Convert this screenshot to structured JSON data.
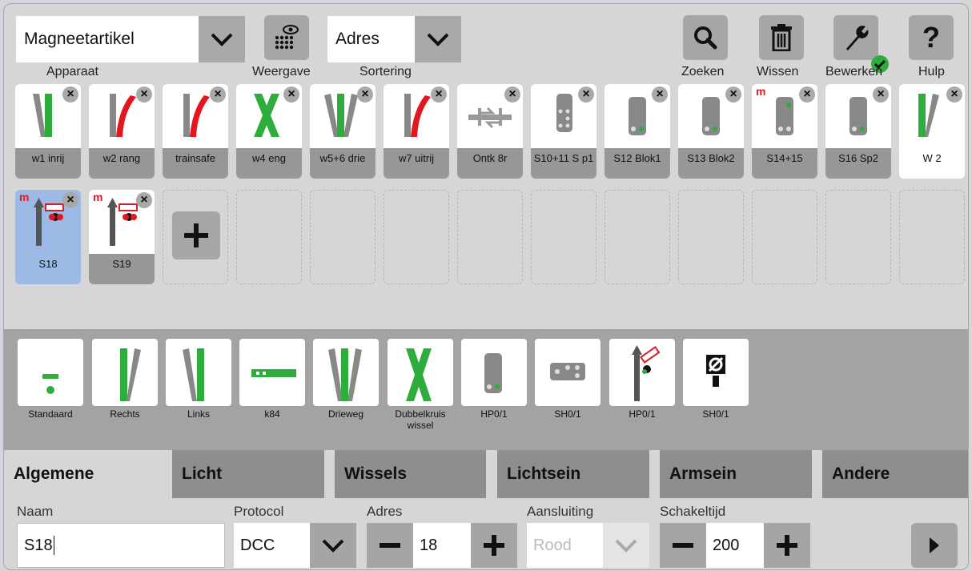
{
  "top": {
    "apparaat": {
      "value": "Magneetartikel",
      "label": "Apparaat"
    },
    "weergave_label": "Weergave",
    "sortering": {
      "value": "Adres",
      "label": "Sortering"
    },
    "zoeken_label": "Zoeken",
    "wissen_label": "Wissen",
    "bewerken_label": "Bewerken",
    "hulp_label": "Hulp",
    "icons": [
      "chevron-down-icon",
      "display-eye-icon",
      "search-icon",
      "trash-icon",
      "wrench-icon",
      "check-badge-icon",
      "help-icon"
    ]
  },
  "articles": [
    {
      "name": "w1 inrij",
      "type": "switch-left"
    },
    {
      "name": "w2 rang",
      "type": "switch-right-red"
    },
    {
      "name": "trainsafe",
      "type": "switch-right-red"
    },
    {
      "name": "w4 eng",
      "type": "double-slip"
    },
    {
      "name": "w5+6 drie",
      "type": "three-way"
    },
    {
      "name": "w7 uitrij",
      "type": "switch-right-red"
    },
    {
      "name": "Ontk 8r",
      "type": "uncoupler"
    },
    {
      "name": "S10+11 S p1",
      "type": "light-signal-sh"
    },
    {
      "name": "S12 Blok1",
      "type": "light-signal-hp"
    },
    {
      "name": "S13 Blok2",
      "type": "light-signal-hp"
    },
    {
      "name": "S14+15",
      "type": "light-signal-hp",
      "marker": "m"
    },
    {
      "name": "S16 Sp2",
      "type": "light-signal-hp"
    },
    {
      "name": "W 2",
      "type": "switch-right"
    },
    {
      "name": "S18",
      "type": "semaphore",
      "marker": "m",
      "selected": true
    },
    {
      "name": "S19",
      "type": "semaphore",
      "marker": "m"
    }
  ],
  "palette": [
    {
      "label": "Standaard"
    },
    {
      "label": "Rechts"
    },
    {
      "label": "Links"
    },
    {
      "label": "k84"
    },
    {
      "label": "Drieweg"
    },
    {
      "label": "Dubbelkruis wissel"
    },
    {
      "label": "HP0/1"
    },
    {
      "label": "SH0/1"
    },
    {
      "label": "HP0/1"
    },
    {
      "label": "SH0/1"
    }
  ],
  "tabs": [
    "Algemene",
    "Licht",
    "Wissels",
    "Lichtsein",
    "Armsein",
    "Andere"
  ],
  "form": {
    "naam": {
      "label": "Naam",
      "value": "S18"
    },
    "protocol": {
      "label": "Protocol",
      "value": "DCC"
    },
    "adres": {
      "label": "Adres",
      "value": "18"
    },
    "aansluiting": {
      "label": "Aansluiting",
      "value": "Rood"
    },
    "schakeltijd": {
      "label": "Schakeltijd",
      "value": "200"
    }
  },
  "colors": {
    "green": "#2eac3c",
    "red": "#e3161f",
    "selected": "#9db9e6",
    "button": "#a6a6a6"
  }
}
